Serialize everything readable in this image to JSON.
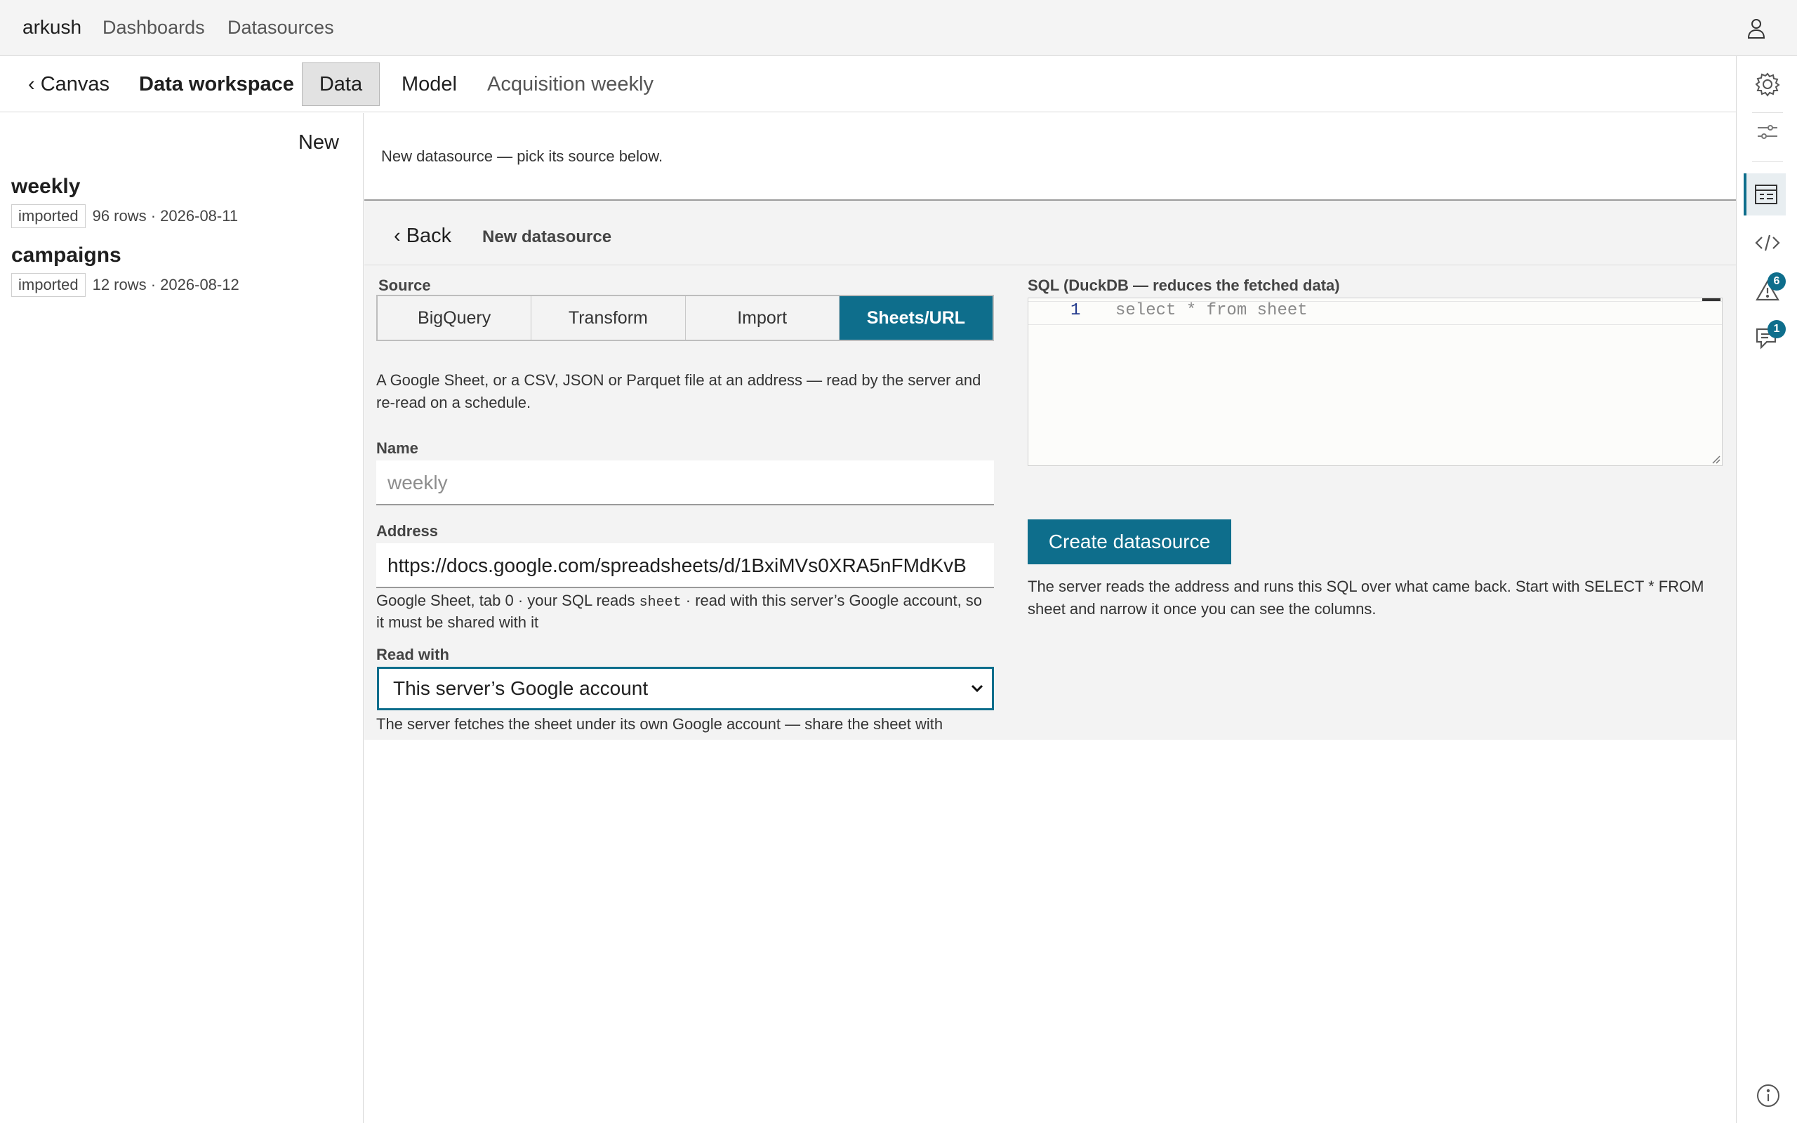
{
  "topbar": {
    "brand": "arkush",
    "nav": [
      "Dashboards",
      "Datasources"
    ]
  },
  "workspace": {
    "back_label": "‹ Canvas",
    "title": "Data workspace",
    "tabs": [
      "Data",
      "Model",
      "Acquisition weekly"
    ],
    "active_tab": "Data"
  },
  "sidebar": {
    "new_label": "New",
    "datasources": [
      {
        "name": "weekly",
        "badge": "imported",
        "meta": "96 rows · 2026-08-11"
      },
      {
        "name": "campaigns",
        "badge": "imported",
        "meta": "12 rows · 2026-08-12"
      }
    ]
  },
  "main": {
    "intro": "New datasource — pick its source below."
  },
  "panel": {
    "back_label": "‹ Back",
    "title": "New datasource",
    "source_label": "Source",
    "source_options": [
      "BigQuery",
      "Transform",
      "Import",
      "Sheets/URL"
    ],
    "selected_source": "Sheets/URL",
    "description": "A Google Sheet, or a CSV, JSON or Parquet file at an address — read by the server and re-read on a schedule.",
    "name_label": "Name",
    "name_placeholder": "weekly",
    "address_label": "Address",
    "address_value": "https://docs.google.com/spreadsheets/d/1BxiMVs0XRA5nFMdKvB",
    "address_hint_pre": "Google Sheet, tab 0 · your SQL reads ",
    "address_hint_code": "sheet",
    "address_hint_post": " · read with this server’s Google account, so it must be shared with it",
    "read_with_label": "Read with",
    "read_with_value": "This server’s Google account",
    "read_with_hint": "The server fetches the sheet under its own Google account — share the sheet with",
    "sql_label": "SQL (DuckDB — reduces the fetched data)",
    "sql_line_number": "1",
    "sql_code": "select * from sheet",
    "create_label": "Create datasource",
    "create_note": "The server reads the address and runs this SQL over what came back. Start with SELECT * FROM sheet and narrow it once you can see the columns."
  },
  "rail": {
    "icons": [
      "settings-icon",
      "sliders-icon",
      "table-icon",
      "code-icon",
      "warning-icon",
      "comments-icon",
      "info-icon"
    ],
    "warning_count": "6",
    "comments_count": "1"
  },
  "colors": {
    "accent": "#0e6e8c",
    "panel_bg": "#f3f3f3",
    "topbar_bg": "#f4f4f4"
  }
}
